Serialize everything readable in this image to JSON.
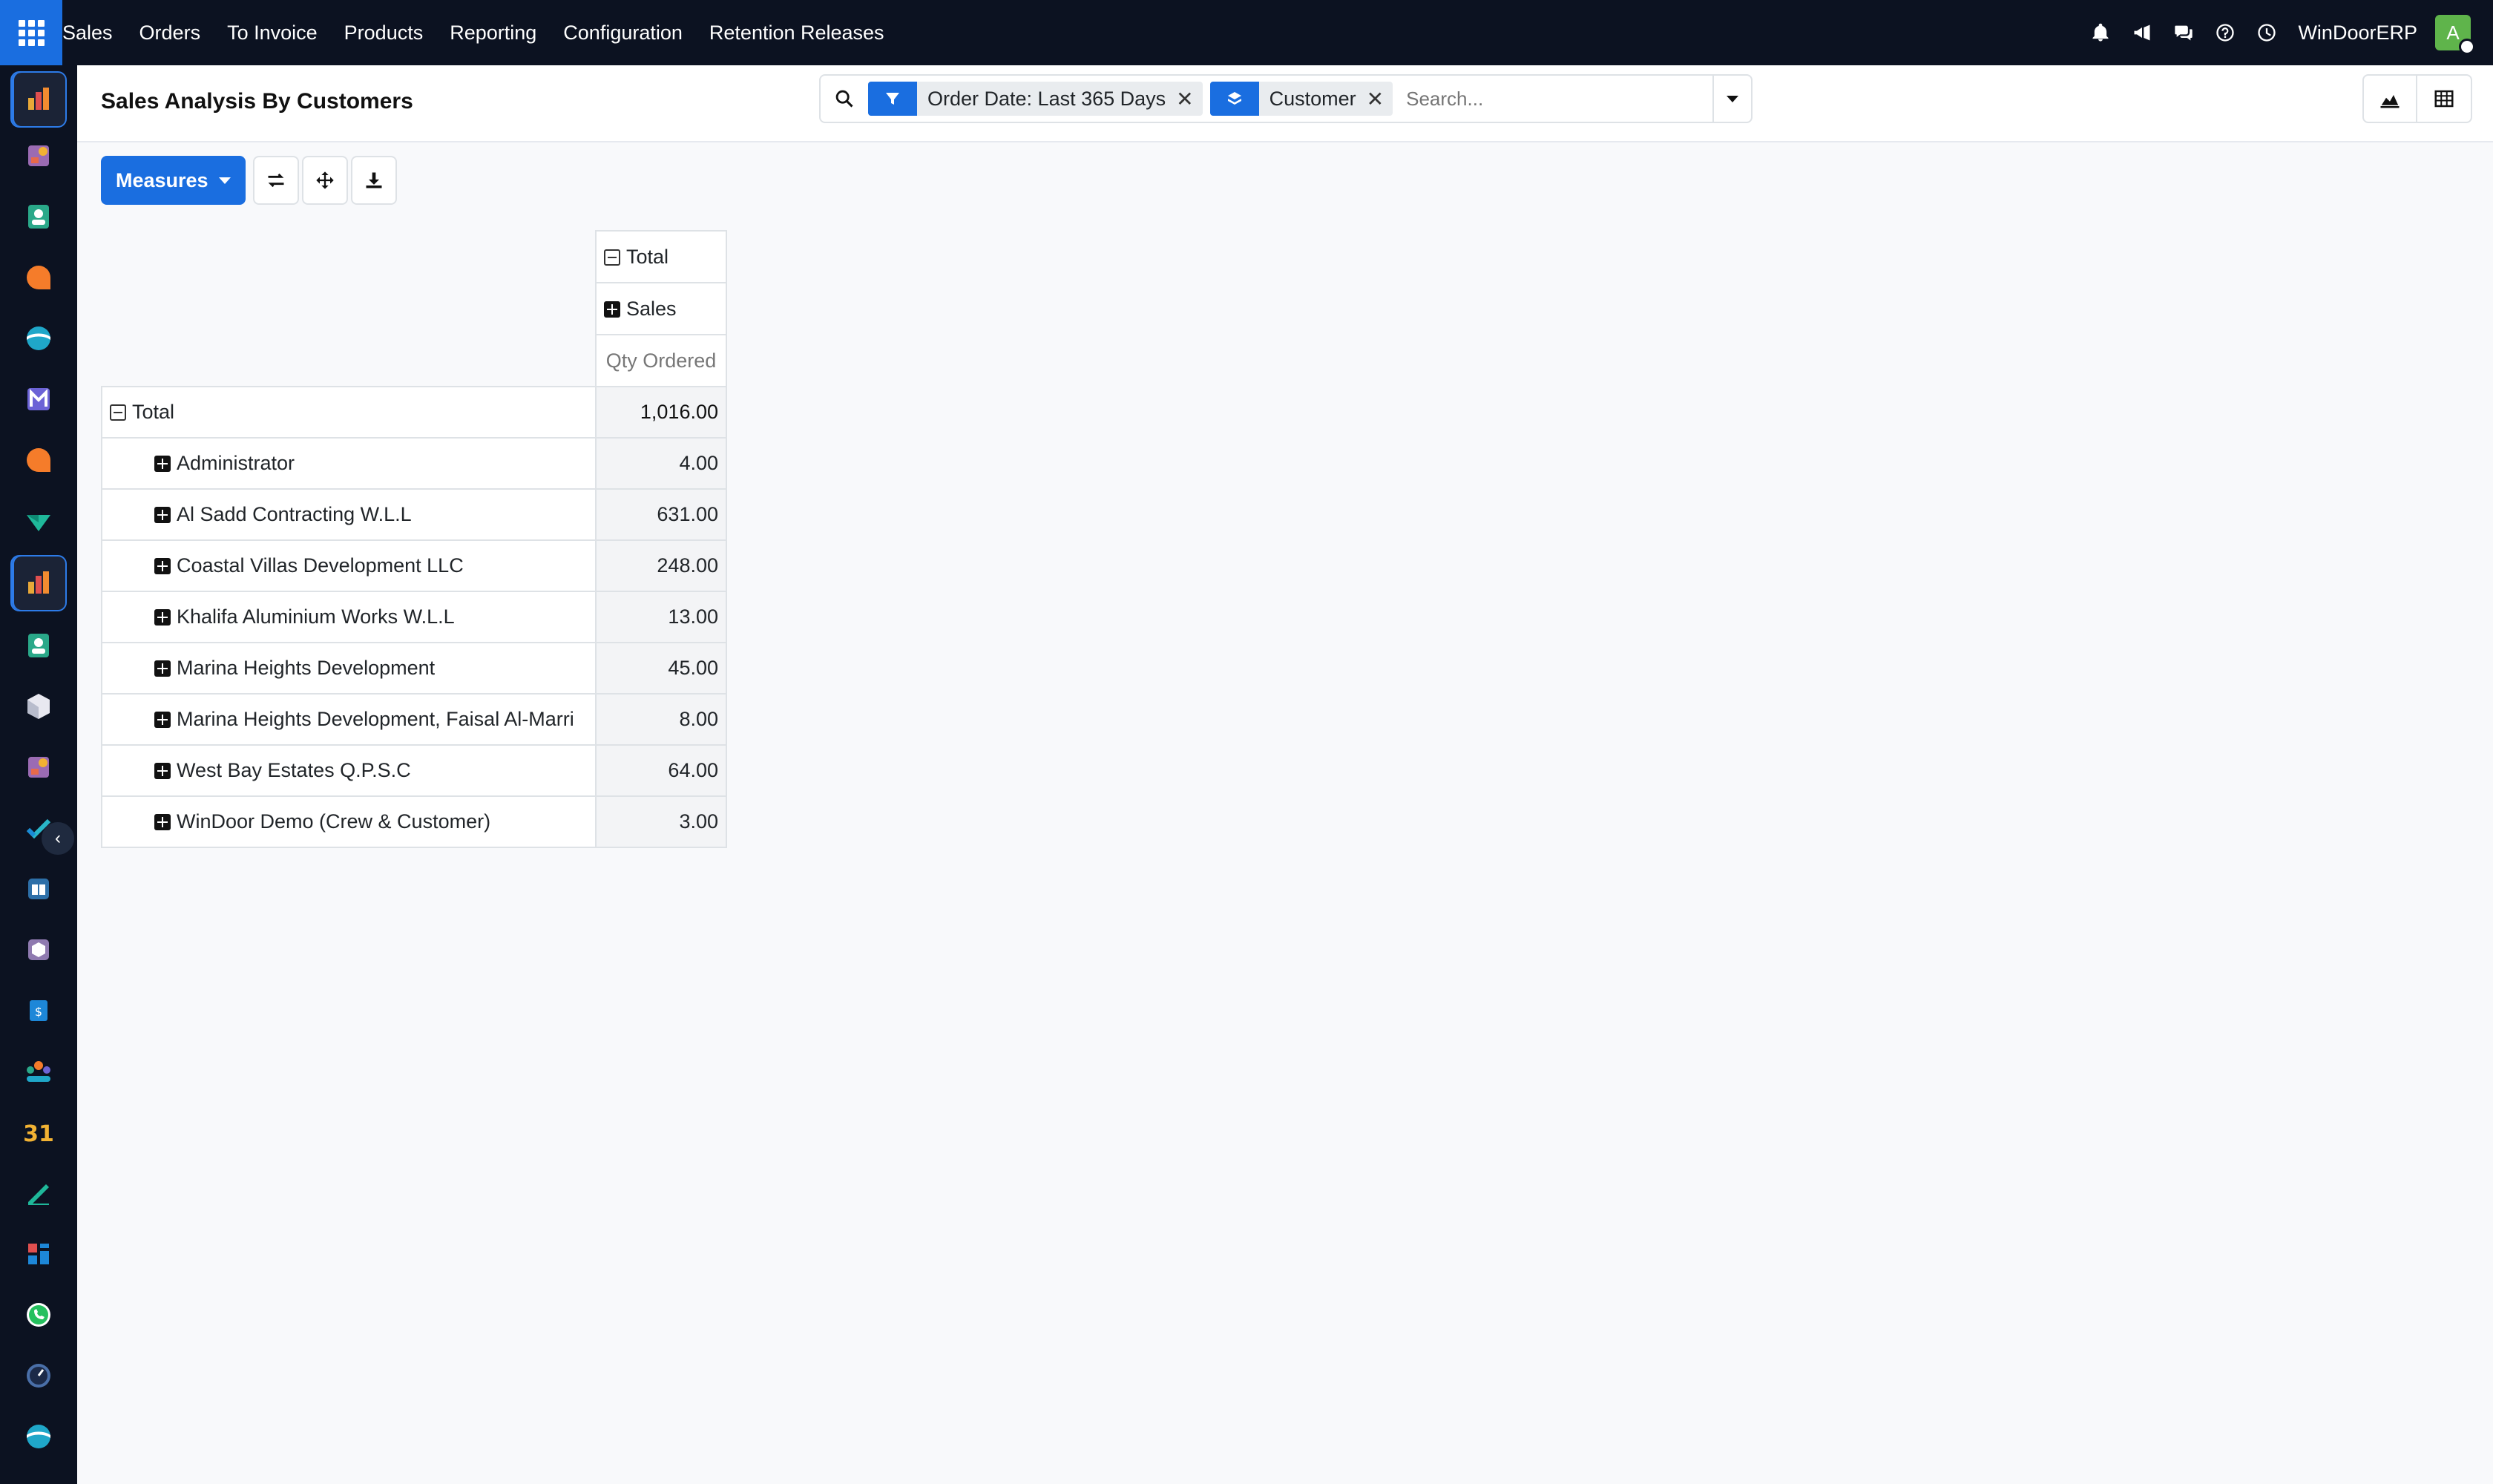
{
  "navbar": {
    "menu": [
      "Sales",
      "Orders",
      "To Invoice",
      "Products",
      "Reporting",
      "Configuration",
      "Retention Releases"
    ],
    "company": "WinDoorERP",
    "avatar_letter": "A",
    "icons": [
      "bell-icon",
      "megaphone-icon",
      "chat-icon",
      "help-icon",
      "clock-icon"
    ]
  },
  "dock": {
    "apps": [
      "sales-app-icon",
      "project-app-icon",
      "contacts-app-icon",
      "discuss-app-icon",
      "website-app-icon",
      "email-marketing-app-icon",
      "live-chat-app-icon",
      "inventory-app-icon",
      "sales-app-icon",
      "employees-app-icon",
      "purchase-app-icon",
      "field-service-app-icon",
      "tasks-app-icon",
      "knowledge-app-icon",
      "manufacturing-app-icon",
      "accounting-app-icon",
      "team-app-icon",
      "calendar-app-icon",
      "sign-app-icon",
      "dashboards-app-icon",
      "whatsapp-app-icon",
      "time-off-app-icon",
      "website-app-icon"
    ],
    "calendar_day": "31"
  },
  "control": {
    "title": "Sales Analysis By Customers",
    "facets": [
      {
        "icon": "filter-icon",
        "label": "Order Date: Last 365 Days"
      },
      {
        "icon": "group-by-layers-icon",
        "label": "Customer"
      }
    ],
    "search_placeholder": "Search..."
  },
  "toolbar": {
    "measures_label": "Measures"
  },
  "pivot": {
    "col_total": "Total",
    "col_group": "Sales",
    "measure": "Qty Ordered",
    "row_total": "Total",
    "grand_total": "1,016.00",
    "rows": [
      {
        "label": "Administrator",
        "value": "4.00"
      },
      {
        "label": "Al Sadd Contracting W.L.L",
        "value": "631.00"
      },
      {
        "label": "Coastal Villas Development LLC",
        "value": "248.00"
      },
      {
        "label": "Khalifa Aluminium Works W.L.L",
        "value": "13.00"
      },
      {
        "label": "Marina Heights Development",
        "value": "45.00"
      },
      {
        "label": "Marina Heights Development, Faisal Al-Marri",
        "value": "8.00"
      },
      {
        "label": "West Bay Estates Q.P.S.C",
        "value": "64.00"
      },
      {
        "label": "WinDoor Demo (Crew & Customer)",
        "value": "3.00"
      }
    ]
  },
  "colors": {
    "navbar_bg": "#0c1221",
    "accent": "#1a6ee0",
    "page_bg": "#f8f9fb"
  }
}
